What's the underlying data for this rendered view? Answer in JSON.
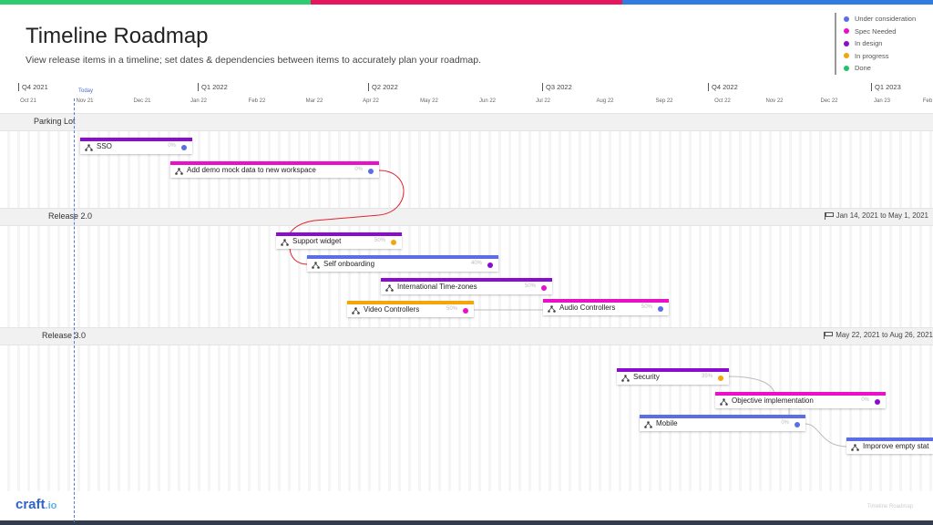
{
  "colors": {
    "top_bar": [
      "#2ecc71",
      "#e5175f",
      "#2f7de1"
    ],
    "under_consideration": "#5b6ee8",
    "spec_needed": "#ea10c8",
    "in_design": "#8a0ccc",
    "in_progress": "#f2a60a",
    "done": "#21c26a"
  },
  "header": {
    "title": "Timeline Roadmap",
    "subtitle": "View release items in a timeline; set dates & dependencies between items to accurately plan your roadmap."
  },
  "legend": [
    {
      "label": "Under consideration",
      "color": "#5b6ee8"
    },
    {
      "label": "Spec Needed",
      "color": "#ea10c8"
    },
    {
      "label": "In design",
      "color": "#8a0ccc"
    },
    {
      "label": "In progress",
      "color": "#f2a60a"
    },
    {
      "label": "Done",
      "color": "#21c26a"
    }
  ],
  "timeline": {
    "quarters": [
      "Q4 2021",
      "Q1 2022",
      "Q2 2022",
      "Q3 2022",
      "Q4 2022",
      "Q1 2023"
    ],
    "months": [
      "Oct 21",
      "Nov 21",
      "Dec 21",
      "Jan 22",
      "Feb 22",
      "Mar 22",
      "Apr 22",
      "May 22",
      "Jun 22",
      "Jul 22",
      "Aug 22",
      "Sep 22",
      "Oct 22",
      "Nov 22",
      "Dec 22",
      "Jan 23",
      "Feb"
    ],
    "today_label": "Today"
  },
  "sections": [
    {
      "label": "Parking Lot",
      "date_range": ""
    },
    {
      "label": "Release 2.0",
      "date_range": "Jan 14, 2021 to May 1, 2021"
    },
    {
      "label": "Release 3.0",
      "date_range": "May 22, 2021 to Aug 26, 2021"
    }
  ],
  "items": [
    {
      "label": "SSO",
      "percent": "0%",
      "bar_color": "#8a0ccc",
      "status_color": "#5b6ee8"
    },
    {
      "label": "Add demo mock data to new workspace",
      "percent": "0%",
      "bar_color": "#ea10c8",
      "status_color": "#5b6ee8"
    },
    {
      "label": "Support widget",
      "percent": "50%",
      "bar_color": "#8a0ccc",
      "status_color": "#f2a60a"
    },
    {
      "label": "Self onboarding",
      "percent": "40%",
      "bar_color": "#5b6ee8",
      "status_color": "#8a0ccc"
    },
    {
      "label": "International Time-zones",
      "percent": "50%",
      "bar_color": "#8a0ccc",
      "status_color": "#ea10c8"
    },
    {
      "label": "Video Controllers",
      "percent": "50%",
      "bar_color": "#f2a60a",
      "status_color": "#ea10c8"
    },
    {
      "label": "Audio Controllers",
      "percent": "50%",
      "bar_color": "#ea10c8",
      "status_color": "#5b6ee8"
    },
    {
      "label": "Security",
      "percent": "35%",
      "bar_color": "#8a0ccc",
      "status_color": "#f2a60a"
    },
    {
      "label": "Objective implementation",
      "percent": "0%",
      "bar_color": "#ea10c8",
      "status_color": "#8a0ccc"
    },
    {
      "label": "Mobile",
      "percent": "0%",
      "bar_color": "#5b6ee8",
      "status_color": "#5b6ee8"
    },
    {
      "label": "Imporove empty stat",
      "percent": "",
      "bar_color": "#5b6ee8",
      "status_color": "#5b6ee8"
    }
  ],
  "footer": {
    "logo": "craft",
    "logo_suffix": ".io",
    "text": "Timeline Roadmap"
  }
}
